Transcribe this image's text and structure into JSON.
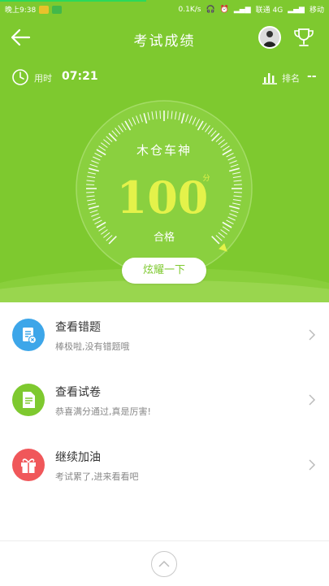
{
  "status_bar": {
    "time": "晚上9:38",
    "speed": "0.1K/s",
    "carrier": "联通 4G",
    "carrier2": "移动"
  },
  "header": {
    "title": "考试成绩"
  },
  "time_row": {
    "label": "用时",
    "value": "07:21",
    "rank_label": "排名",
    "rank_value": "--"
  },
  "result": {
    "name": "木仓车神",
    "score": "100",
    "unit": "分",
    "verdict": "合格",
    "progress": 1.0
  },
  "share_button": "炫耀一下",
  "items": [
    {
      "title": "查看错题",
      "subtitle": "棒极啦,没有错题哦",
      "color": "#3da6e9",
      "icon": "wrong-questions-icon"
    },
    {
      "title": "查看试卷",
      "subtitle": "恭喜满分通过,真是厉害!",
      "color": "#7ec92f",
      "icon": "exam-paper-icon"
    },
    {
      "title": "继续加油",
      "subtitle": "考试累了,进来看看吧",
      "color": "#f0575a",
      "icon": "gift-icon"
    }
  ],
  "colors": {
    "primary_green": "#7ec92f",
    "score_yellow": "#e4f24a"
  }
}
